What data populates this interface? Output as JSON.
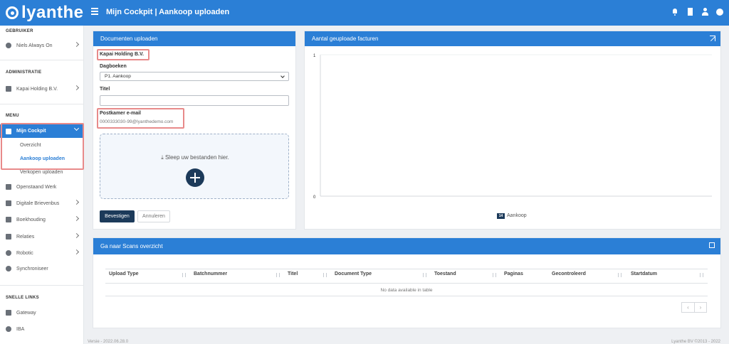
{
  "header": {
    "logo_text": "lyanthe",
    "title": "Mijn Cockpit | Aankoop uploaden",
    "icons": [
      "bell-icon",
      "building-icon",
      "user-icon",
      "palette-icon"
    ]
  },
  "sidebar": {
    "gebruiker_title": "GEBRUIKER",
    "user_name": "Niels Always On",
    "administratie_title": "ADMINISTRATIE",
    "company": "Kapai Holding B.V.",
    "menu_title": "MENU",
    "active_item": "Mijn Cockpit",
    "sub_items": [
      "Overzicht",
      "Aankoop uploaden",
      "Verkopen uploaden"
    ],
    "items": [
      "Openstaand Werk",
      "Digitale Brievenbus",
      "Boekhouding",
      "Relaties",
      "Robotic",
      "Synchroniseer"
    ],
    "snelle_title": "SNELLE LINKS",
    "links": [
      "Gateway",
      "IBA"
    ]
  },
  "upload_card": {
    "title": "Documenten uploaden",
    "company": "Kapai Holding B.V.",
    "dagboeken_label": "Dagboeken",
    "dagboeken_value": "P1. Aankoop",
    "titel_label": "Titel",
    "titel_value": "",
    "postkamer_label": "Postkamer e-mail",
    "postkamer_value": "0000333030-99@lyanthedemo.com",
    "drop_text": "Sleep uw bestanden hier.",
    "confirm_label": "Bevestigen",
    "cancel_label": "Annuleren"
  },
  "chart_card": {
    "title": "Aantal geuploade facturen"
  },
  "chart_data": {
    "type": "bar",
    "title": "Aantal geuploade facturen",
    "series": [
      {
        "name": "Aankoop",
        "values": []
      }
    ],
    "legend_badge": "14",
    "y_ticks": [
      "1",
      "0"
    ],
    "ylim": [
      0,
      1
    ],
    "legend_position": "bottom-center"
  },
  "scans_card": {
    "title": "Ga naar Scans overzicht",
    "columns": [
      "Upload Type",
      "Batchnummer",
      "Titel",
      "Document Type",
      "Toestand",
      "Paginas",
      "Gecontroleerd",
      "Startdatum"
    ],
    "empty_text": "No data available in table",
    "pager_prev": "‹",
    "pager_next": "›"
  },
  "footer": {
    "left": "Versie - 2022.06.28.0",
    "right": "Lyanthe BV ©2013 - 2022"
  },
  "colors": {
    "accent": "#2b7fd6",
    "dark": "#1c3a5a",
    "highlight": "#e88a8a"
  }
}
